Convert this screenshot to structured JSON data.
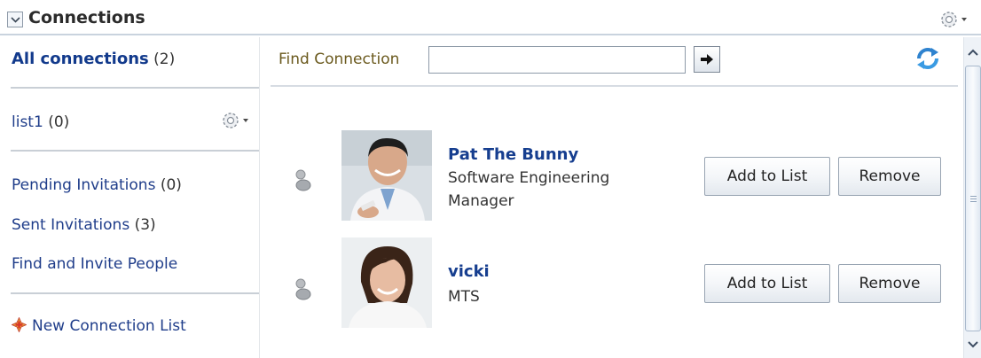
{
  "panel": {
    "title": "Connections"
  },
  "sidebar": {
    "all": {
      "label": "All connections",
      "count": "(2)"
    },
    "list1": {
      "label": "list1",
      "count": "(0)"
    },
    "pending": {
      "label": "Pending Invitations",
      "count": "(0)"
    },
    "sent": {
      "label": "Sent Invitations",
      "count": "(3)"
    },
    "find_invite": {
      "label": "Find and Invite People"
    },
    "new_list": {
      "label": "New Connection List"
    }
  },
  "search": {
    "label": "Find Connection",
    "value": "",
    "placeholder": ""
  },
  "connections": [
    {
      "name": "Pat The Bunny",
      "title": "Software Engineering Manager",
      "add_label": "Add to List",
      "remove_label": "Remove"
    },
    {
      "name": "vicki",
      "title": "MTS",
      "add_label": "Add to List",
      "remove_label": "Remove"
    }
  ],
  "icons": {
    "collapse": "chevron-down-icon",
    "panel_menu": "gear-icon",
    "list_menu": "gear-icon",
    "new_list": "add-icon",
    "go": "arrow-right-icon",
    "refresh": "refresh-icon",
    "presence": "presence-icon"
  },
  "colors": {
    "link": "#1f3d8a",
    "accent_label": "#6b5a1e",
    "refresh": "#3a8ed6"
  }
}
